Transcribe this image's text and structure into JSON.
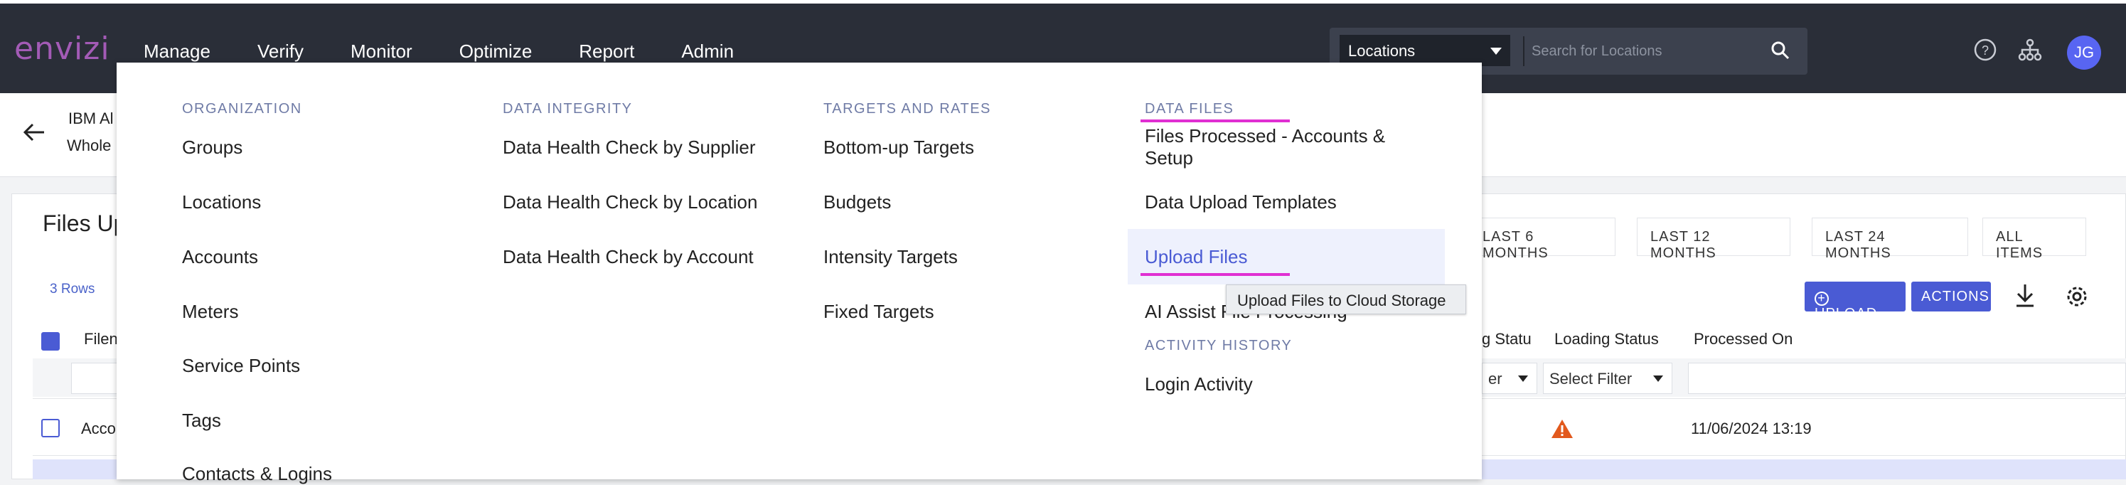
{
  "brand": {
    "logo_text": "envizi",
    "accent_color": "#a35bb6"
  },
  "nav": {
    "items": [
      "Manage",
      "Verify",
      "Monitor",
      "Optimize",
      "Report",
      "Admin"
    ],
    "active": "Manage",
    "active_color": "#e02fd2"
  },
  "search": {
    "scope": "Locations",
    "placeholder": "Search for Locations"
  },
  "user": {
    "initials": "JG"
  },
  "breadcrumb": {
    "line1": "IBM Al",
    "line2": "Whole"
  },
  "panel": {
    "title": "Files Up",
    "rows_count": "3 Rows",
    "filters": [
      "LAST 6 MONTHS",
      "LAST 12 MONTHS",
      "LAST 24 MONTHS",
      "ALL ITEMS"
    ],
    "upload_label": "UPLOAD",
    "actions_label": "ACTIONS",
    "columns": [
      "Filen",
      "g Statu",
      "Loading Status",
      "Processed On"
    ],
    "filter_placeholder": "Select Filter",
    "filter_partial": "er",
    "rows": [
      {
        "name": "Acco",
        "processed_on": "11/06/2024 13:19",
        "status_icon": "warning-icon"
      }
    ]
  },
  "menu": {
    "columns": [
      {
        "title": "ORGANIZATION",
        "items": [
          "Groups",
          "Locations",
          "Accounts",
          "Meters",
          "Service Points",
          "Tags",
          "Contacts & Logins"
        ]
      },
      {
        "title": "DATA INTEGRITY",
        "items": [
          "Data Health Check by Supplier",
          "Data Health Check by Location",
          "Data Health Check by Account"
        ]
      },
      {
        "title": "TARGETS AND RATES",
        "items": [
          "Bottom-up Targets",
          "Budgets",
          "Intensity Targets",
          "Fixed Targets"
        ]
      },
      {
        "title": "DATA FILES",
        "items": [
          "Files Processed - Accounts &",
          "Setup",
          "Data Upload Templates",
          "Upload Files",
          "AI Assist File Processing"
        ]
      },
      {
        "title": "ACTIVITY HISTORY",
        "items": [
          "Login Activity"
        ]
      }
    ],
    "tooltip": "Upload Files to Cloud Storage"
  }
}
